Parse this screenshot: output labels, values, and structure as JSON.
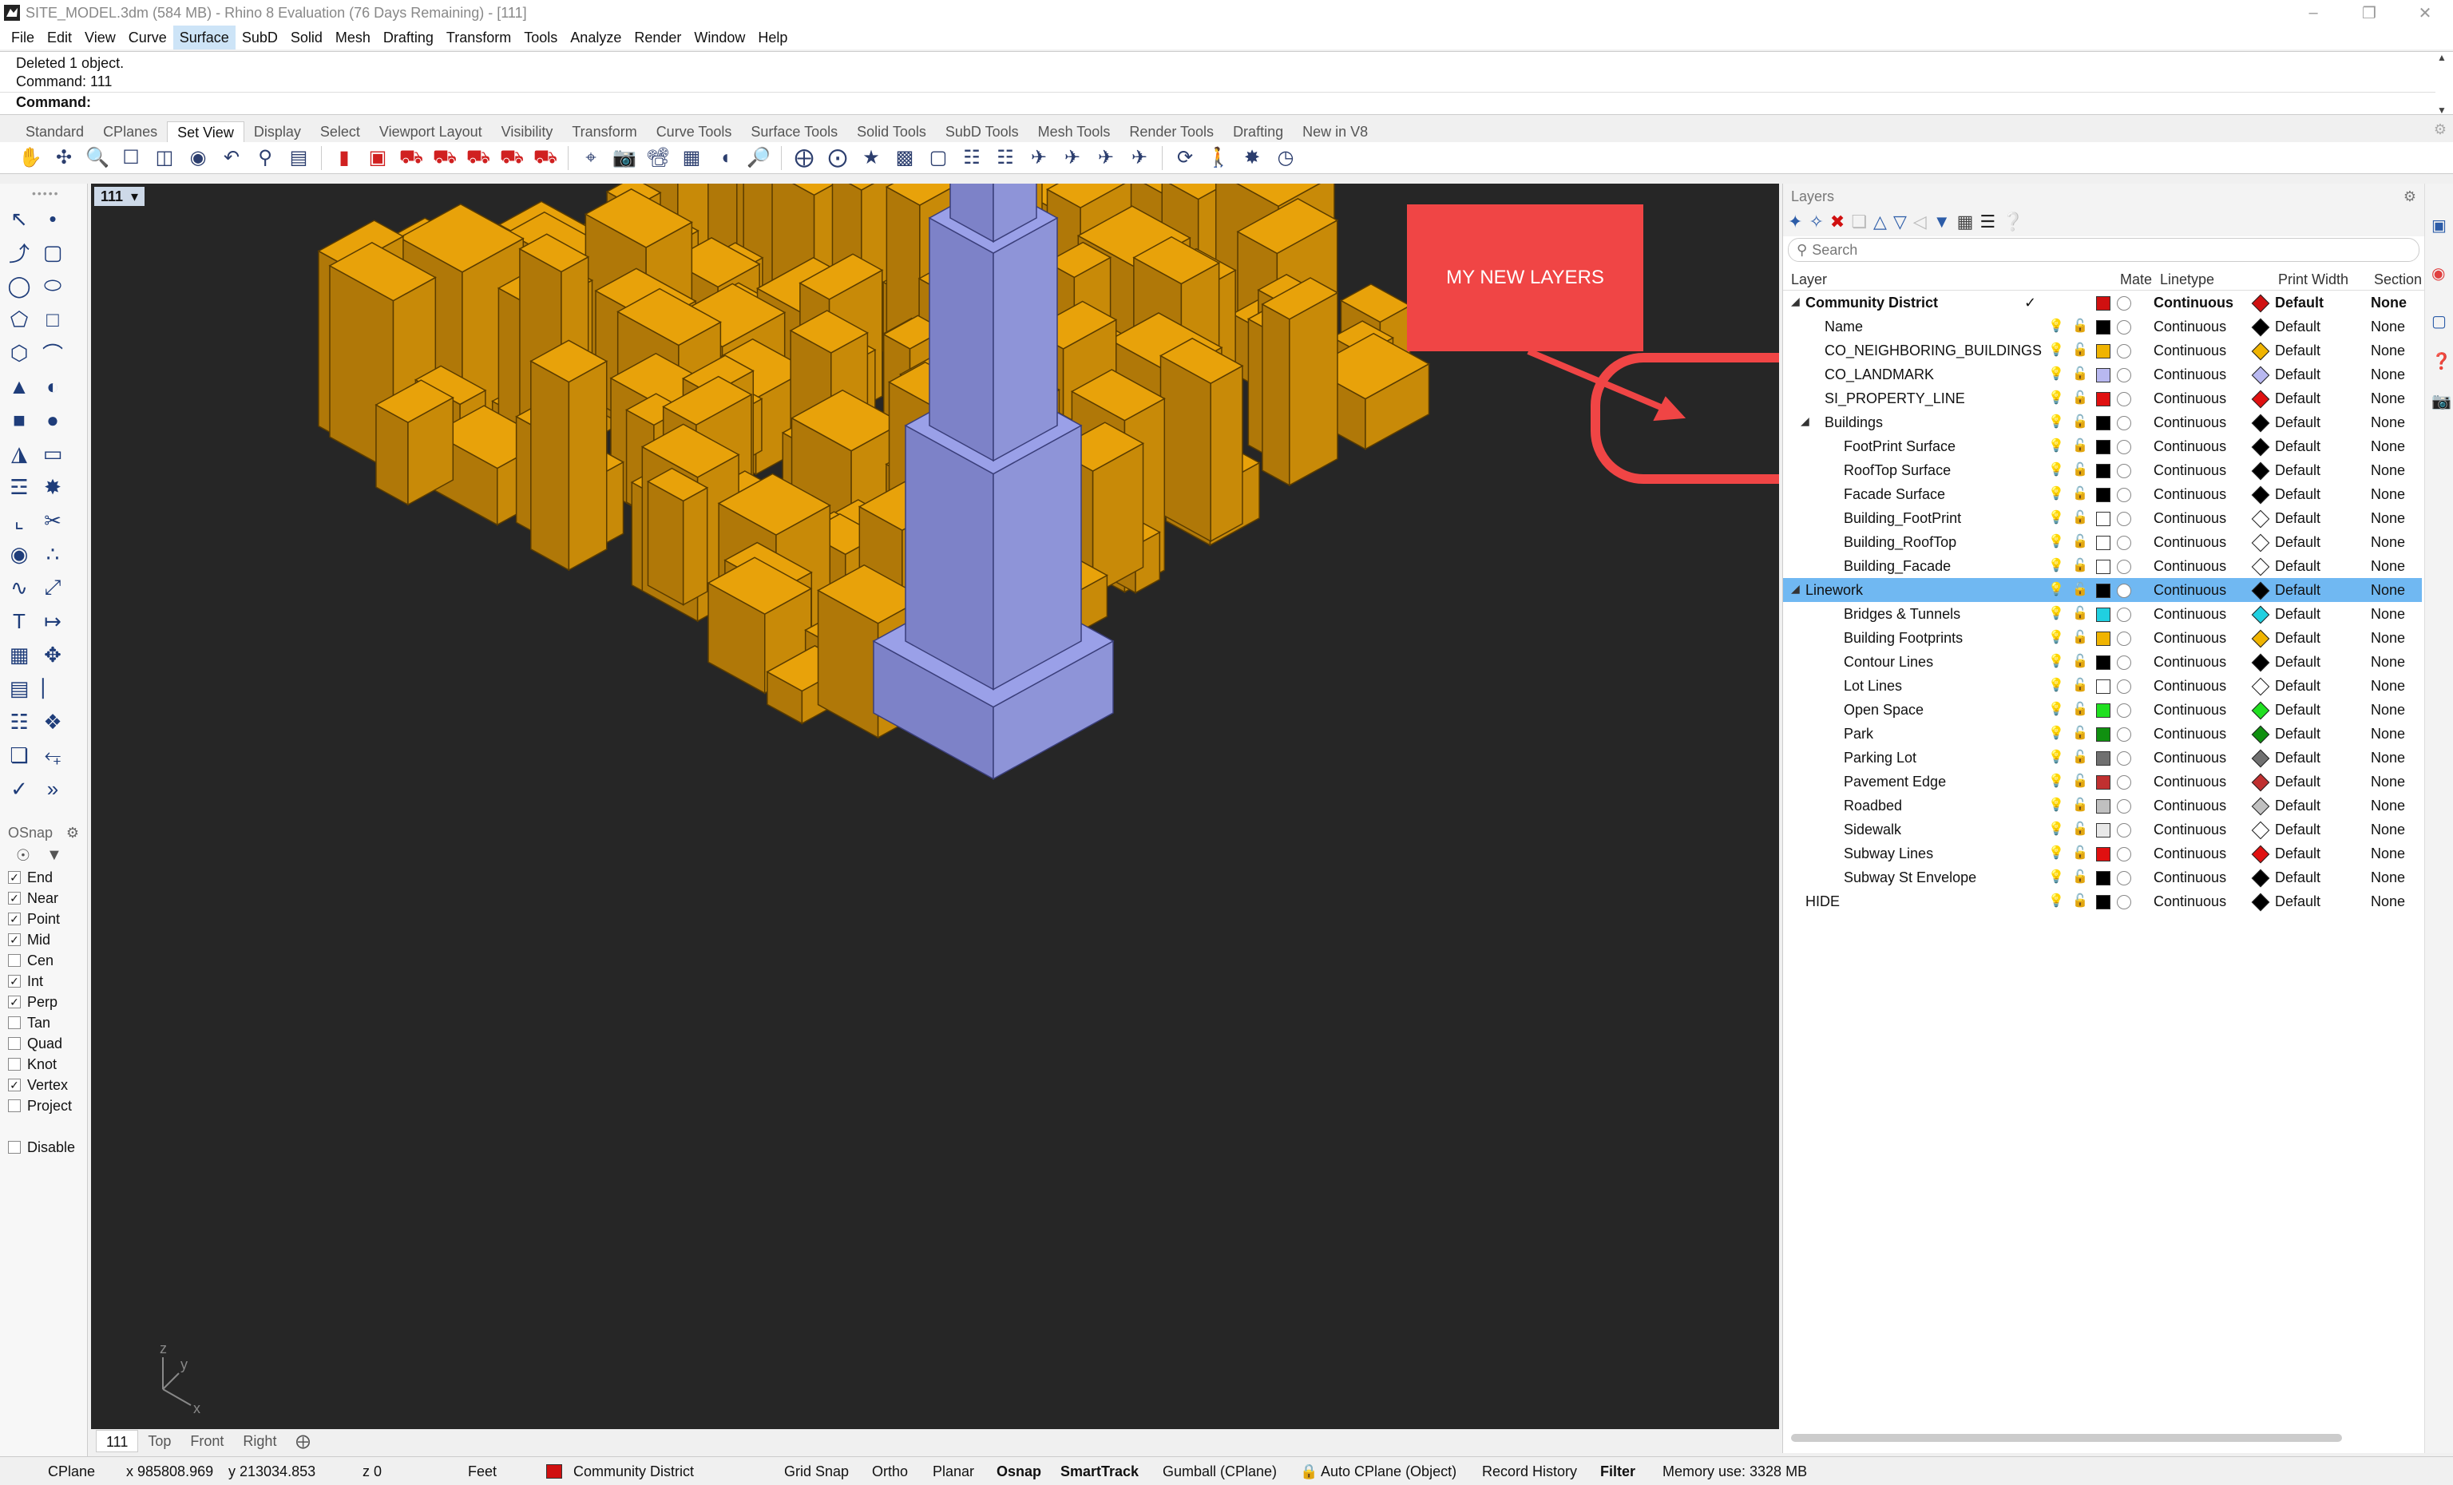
{
  "window": {
    "title": "SITE_MODEL.3dm (584 MB) - Rhino 8 Evaluation (76 Days Remaining) - [111]"
  },
  "menu": [
    "File",
    "Edit",
    "View",
    "Curve",
    "Surface",
    "SubD",
    "Solid",
    "Mesh",
    "Drafting",
    "Transform",
    "Tools",
    "Analyze",
    "Render",
    "Window",
    "Help"
  ],
  "command": {
    "history1": "Deleted 1 object.",
    "history2": "Command: 111",
    "prompt": "Command:"
  },
  "toolbar_tabs": [
    "Standard",
    "CPlanes",
    "Set View",
    "Display",
    "Select",
    "Viewport Layout",
    "Visibility",
    "Transform",
    "Curve Tools",
    "Surface Tools",
    "Solid Tools",
    "SubD Tools",
    "Mesh Tools",
    "Render Tools",
    "Drafting",
    "New in V8"
  ],
  "active_toolbar_tab": "Set View",
  "osnap": {
    "title": "OSnap",
    "items": [
      {
        "label": "End",
        "checked": true
      },
      {
        "label": "Near",
        "checked": true
      },
      {
        "label": "Point",
        "checked": true
      },
      {
        "label": "Mid",
        "checked": true
      },
      {
        "label": "Cen",
        "checked": false
      },
      {
        "label": "Int",
        "checked": true
      },
      {
        "label": "Perp",
        "checked": true
      },
      {
        "label": "Tan",
        "checked": false
      },
      {
        "label": "Quad",
        "checked": false
      },
      {
        "label": "Knot",
        "checked": false
      },
      {
        "label": "Vertex",
        "checked": true
      },
      {
        "label": "Project",
        "checked": false
      }
    ],
    "disable": {
      "label": "Disable",
      "checked": false
    }
  },
  "viewport": {
    "label": "111",
    "annotation": "MY NEW LAYERS",
    "axis_y": "y",
    "axis_z": "z",
    "axis_x": "x",
    "colors": {
      "buildings": "#e8a20a",
      "landmark": "#9aa0e8",
      "background": "#262626",
      "annotation": "#f04545"
    }
  },
  "viewport_tabs": [
    "111",
    "Top",
    "Front",
    "Right"
  ],
  "layers_panel": {
    "title": "Layers",
    "search_placeholder": "Search",
    "columns": {
      "layer": "Layer",
      "material": "Mate",
      "linetype": "Linetype",
      "print_width": "Print Width",
      "section": "Section"
    },
    "rows": [
      {
        "name": "Community District",
        "indent": 0,
        "expand": "down",
        "bold": true,
        "current": true,
        "color": "#d01010",
        "linetype": "Continuous",
        "print_color": "#d01010",
        "print_width": "Default",
        "section": "None"
      },
      {
        "name": "Name",
        "indent": 1,
        "color": "#000000",
        "linetype": "Continuous",
        "print_color": "#000000",
        "print_width": "Default",
        "section": "None"
      },
      {
        "name": "CO_NEIGHBORING_BUILDINGS",
        "indent": 1,
        "color": "#f0b400",
        "linetype": "Continuous",
        "print_color": "#f0b400",
        "print_width": "Default",
        "section": "None"
      },
      {
        "name": "CO_LANDMARK",
        "indent": 1,
        "color": "#b8b8f0",
        "linetype": "Continuous",
        "print_color": "#b8b8f0",
        "print_width": "Default",
        "section": "None"
      },
      {
        "name": "SI_PROPERTY_LINE",
        "indent": 1,
        "color": "#e01010",
        "linetype": "Continuous",
        "print_color": "#e01010",
        "print_width": "Default",
        "section": "None"
      },
      {
        "name": "Buildings",
        "indent": 1,
        "expand": "down",
        "color": "#000000",
        "linetype": "Continuous",
        "print_color": "#000000",
        "print_width": "Default",
        "section": "None"
      },
      {
        "name": "FootPrint Surface",
        "indent": 2,
        "color": "#000000",
        "linetype": "Continuous",
        "print_color": "#000000",
        "print_width": "Default",
        "section": "None"
      },
      {
        "name": "RoofTop Surface",
        "indent": 2,
        "color": "#000000",
        "linetype": "Continuous",
        "print_color": "#000000",
        "print_width": "Default",
        "section": "None"
      },
      {
        "name": "Facade Surface",
        "indent": 2,
        "color": "#000000",
        "linetype": "Continuous",
        "print_color": "#000000",
        "print_width": "Default",
        "section": "None"
      },
      {
        "name": "Building_FootPrint",
        "indent": 2,
        "color": "#ffffff",
        "linetype": "Continuous",
        "print_color": "#ffffff",
        "print_width": "Default",
        "section": "None"
      },
      {
        "name": "Building_RoofTop",
        "indent": 2,
        "color": "#ffffff",
        "linetype": "Continuous",
        "print_color": "#ffffff",
        "print_width": "Default",
        "section": "None"
      },
      {
        "name": "Building_Facade",
        "indent": 2,
        "color": "#ffffff",
        "linetype": "Continuous",
        "print_color": "#ffffff",
        "print_width": "Default",
        "section": "None"
      },
      {
        "name": "Linework",
        "indent": 0,
        "expand": "down",
        "selected": true,
        "color": "#000000",
        "linetype": "Continuous",
        "print_color": "#000000",
        "print_width": "Default",
        "section": "None"
      },
      {
        "name": "Bridges & Tunnels",
        "indent": 2,
        "color": "#20d0e0",
        "linetype": "Continuous",
        "print_color": "#20d0e0",
        "print_width": "Default",
        "section": "None"
      },
      {
        "name": "Building Footprints",
        "indent": 2,
        "color": "#f0b400",
        "linetype": "Continuous",
        "print_color": "#f0b400",
        "print_width": "Default",
        "section": "None"
      },
      {
        "name": "Contour Lines",
        "indent": 2,
        "color": "#000000",
        "linetype": "Continuous",
        "print_color": "#000000",
        "print_width": "Default",
        "section": "None"
      },
      {
        "name": "Lot Lines",
        "indent": 2,
        "color": "#ffffff",
        "linetype": "Continuous",
        "print_color": "#ffffff",
        "print_width": "Default",
        "section": "None"
      },
      {
        "name": "Open Space",
        "indent": 2,
        "color": "#20e020",
        "linetype": "Continuous",
        "print_color": "#20e020",
        "print_width": "Default",
        "section": "None"
      },
      {
        "name": "Park",
        "indent": 2,
        "color": "#109010",
        "linetype": "Continuous",
        "print_color": "#109010",
        "print_width": "Default",
        "section": "None"
      },
      {
        "name": "Parking Lot",
        "indent": 2,
        "color": "#707070",
        "linetype": "Continuous",
        "print_color": "#707070",
        "print_width": "Default",
        "section": "None"
      },
      {
        "name": "Pavement Edge",
        "indent": 2,
        "color": "#c03030",
        "linetype": "Continuous",
        "print_color": "#c03030",
        "print_width": "Default",
        "section": "None"
      },
      {
        "name": "Roadbed",
        "indent": 2,
        "color": "#c0c0c0",
        "linetype": "Continuous",
        "print_color": "#c0c0c0",
        "print_width": "Default",
        "section": "None"
      },
      {
        "name": "Sidewalk",
        "indent": 2,
        "color": "#e8e8e8",
        "linetype": "Continuous",
        "print_color": "#ffffff",
        "print_width": "Default",
        "section": "None"
      },
      {
        "name": "Subway Lines",
        "indent": 2,
        "color": "#e01010",
        "linetype": "Continuous",
        "print_color": "#e01010",
        "print_width": "Default",
        "section": "None"
      },
      {
        "name": "Subway St Envelope",
        "indent": 2,
        "color": "#000000",
        "linetype": "Continuous",
        "print_color": "#000000",
        "print_width": "Default",
        "section": "None"
      },
      {
        "name": "HIDE",
        "indent": 0,
        "color": "#000000",
        "linetype": "Continuous",
        "print_color": "#000000",
        "print_width": "Default",
        "section": "None"
      }
    ]
  },
  "status": {
    "cplane": "CPlane",
    "x": "x 985808.969",
    "y": "y 213034.853",
    "z": "z 0",
    "units": "Feet",
    "layer": "Community District",
    "layer_color": "#d01010",
    "grid_snap": "Grid Snap",
    "ortho": "Ortho",
    "planar": "Planar",
    "osnap": "Osnap",
    "smarttrack": "SmartTrack",
    "gumball": "Gumball (CPlane)",
    "autocplane": "Auto CPlane (Object)",
    "record": "Record History",
    "filter": "Filter",
    "memory": "Memory use: 3328 MB"
  }
}
